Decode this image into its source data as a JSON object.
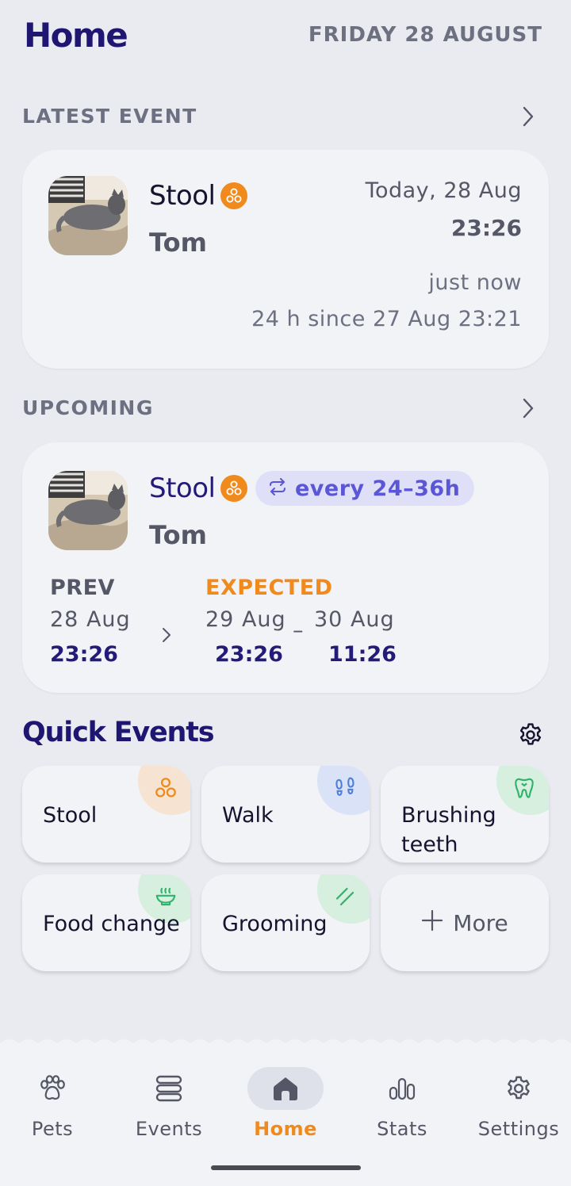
{
  "header": {
    "title": "Home",
    "date": "FRIDAY 28 AUGUST"
  },
  "latest": {
    "section_title": "LATEST EVENT",
    "event_type": "Stool",
    "pet_name": "Tom",
    "date": "Today, 28 Aug",
    "time": "23:26",
    "relative": "just now",
    "since": "24 h since 27 Aug 23:21"
  },
  "upcoming": {
    "section_title": "UPCOMING",
    "event_type": "Stool",
    "pet_name": "Tom",
    "recurrence": "every 24–36h",
    "prev_label": "PREV",
    "prev_date": "28 Aug",
    "prev_time": "23:26",
    "expected_label": "EXPECTED",
    "expected_from_date": "29 Aug",
    "expected_from_time": "23:26",
    "expected_to_date": "30 Aug",
    "expected_to_time": "11:26",
    "range_separator": "–"
  },
  "quick_events": {
    "title": "Quick Events",
    "tiles": [
      {
        "label": "Stool",
        "icon": "stool-icon",
        "color": "#f08a1c",
        "blob": "#f6e3d2"
      },
      {
        "label": "Walk",
        "icon": "footprints-icon",
        "color": "#4f7fd8",
        "blob": "#d9e2f6"
      },
      {
        "label": "Brushing teeth",
        "icon": "tooth-icon",
        "color": "#2fb36a",
        "blob": "#d6efdf"
      },
      {
        "label": "Food change",
        "icon": "bowl-icon",
        "color": "#2fb36a",
        "blob": "#d6efdf"
      },
      {
        "label": "Grooming",
        "icon": "comb-icon",
        "color": "#2fb36a",
        "blob": "#d6efdf"
      },
      {
        "label": "More",
        "icon": "plus-icon"
      }
    ]
  },
  "nav": {
    "items": [
      {
        "label": "Pets",
        "icon": "paw-icon"
      },
      {
        "label": "Events",
        "icon": "stack-icon"
      },
      {
        "label": "Home",
        "icon": "home-icon",
        "active": true
      },
      {
        "label": "Stats",
        "icon": "bar-chart-icon"
      },
      {
        "label": "Settings",
        "icon": "gear-icon"
      }
    ]
  },
  "colors": {
    "accent": "#f08a1c",
    "primary_dark": "#1e1670",
    "pill_bg": "#dfe0f8",
    "pill_text": "#5a56d6",
    "background": "#e9ebf1",
    "card": "#f2f3f7"
  }
}
